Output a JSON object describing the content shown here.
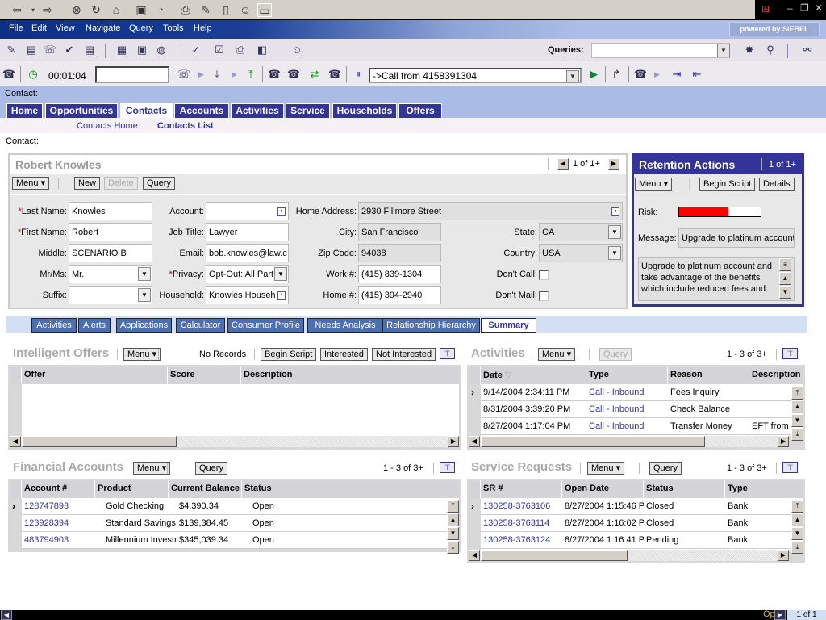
{
  "browser": {
    "icons": [
      "back-icon",
      "forward-icon",
      "stop-icon",
      "refresh-icon",
      "home-icon",
      "folder-icon",
      "history-icon",
      "print-icon",
      "edit-icon",
      "document-icon",
      "user-icon",
      "window-icon"
    ]
  },
  "menu": [
    "File",
    "Edit",
    "View",
    "Navigate",
    "Query",
    "Tools",
    "Help"
  ],
  "powered_by": "powered by SIEBEL",
  "toolbar": {
    "queries_label": "Queries:",
    "queries_value": ""
  },
  "comm": {
    "timer": "00:01:04",
    "input_value": "",
    "call_select": "->Call from 4158391304"
  },
  "context_label": "Contact:",
  "tabs": [
    {
      "label": "Home"
    },
    {
      "label": "Opportunities"
    },
    {
      "label": "Contacts",
      "active": true
    },
    {
      "label": "Accounts"
    },
    {
      "label": "Activities"
    },
    {
      "label": "Service"
    },
    {
      "label": "Households"
    },
    {
      "label": "Offers"
    }
  ],
  "subnav": {
    "home": "Contacts Home",
    "list": "Contacts List"
  },
  "page_label": "Contact:",
  "contact": {
    "title": "Robert Knowles",
    "pager": "1 of 1+",
    "buttons": {
      "menu": "Menu ▾",
      "new": "New",
      "delete": "Delete",
      "query": "Query"
    },
    "fields": {
      "last_name": {
        "label": "Last Name:",
        "value": "Knowles"
      },
      "first_name": {
        "label": "First Name:",
        "value": "Robert"
      },
      "middle": {
        "label": "Middle:",
        "value": "SCENARIO B"
      },
      "mrms": {
        "label": "Mr/Ms:",
        "value": "Mr."
      },
      "suffix": {
        "label": "Suffix:",
        "value": ""
      },
      "account": {
        "label": "Account:",
        "value": ""
      },
      "job_title": {
        "label": "Job Title:",
        "value": "Lawyer"
      },
      "email": {
        "label": "Email:",
        "value": "bob.knowles@law.c"
      },
      "privacy": {
        "label": "Privacy:",
        "value": "Opt-Out: All Part"
      },
      "household": {
        "label": "Household:",
        "value": "Knowles Househ"
      },
      "home_address": {
        "label": "Home Address:",
        "value": "2930 Fillmore Street"
      },
      "city": {
        "label": "City:",
        "value": "San Francisco"
      },
      "zip": {
        "label": "Zip Code:",
        "value": "94038"
      },
      "work": {
        "label": "Work #:",
        "value": "(415) 839-1304"
      },
      "home": {
        "label": "Home #:",
        "value": "(415) 394-2940"
      },
      "state": {
        "label": "State:",
        "value": "CA"
      },
      "country": {
        "label": "Country:",
        "value": "USA"
      },
      "dont_call": {
        "label": "Don't Call:",
        "checked": false
      },
      "dont_mail": {
        "label": "Don't Mail:",
        "checked": false
      }
    }
  },
  "retention": {
    "title": "Retention Actions",
    "pager": "1 of 1+",
    "menu": "Menu ▾",
    "begin_script": "Begin Script",
    "details": "Details",
    "risk_label": "Risk:",
    "risk_level": 0.6,
    "risk_color": "#ff0000",
    "message_label": "Message:",
    "message": "Upgrade to platinum account",
    "body": "Upgrade to platinum account and take advantage of the benefits which include reduced fees and"
  },
  "subtabs": [
    {
      "label": "Activities"
    },
    {
      "label": "Alerts"
    },
    {
      "label": "Applications"
    },
    {
      "label": "Calculator"
    },
    {
      "label": "Consumer Profile"
    },
    {
      "label": "Needs Analysis"
    },
    {
      "label": "Relationship Hierarchy"
    },
    {
      "label": "Summary",
      "active": true
    }
  ],
  "offers": {
    "title": "Intelligent Offers",
    "menu": "Menu ▾",
    "status": "No Records",
    "begin_script": "Begin Script",
    "interested": "Interested",
    "not_interested": "Not Interested",
    "columns": [
      "Offer",
      "Score",
      "Description"
    ]
  },
  "activities": {
    "title": "Activities",
    "menu": "Menu ▾",
    "query": "Query",
    "count": "1 - 3 of 3+",
    "columns": [
      "Date",
      "Type",
      "Reason",
      "Description"
    ],
    "rows": [
      [
        "9/14/2004 2:34:11 PM",
        "Call - Inbound",
        "Fees Inquiry",
        ""
      ],
      [
        "8/31/2004 3:39:20 PM",
        "Call - Inbound",
        "Check Balance",
        ""
      ],
      [
        "8/27/2004 1:17:04 PM",
        "Call - Inbound",
        "Transfer Money",
        "EFT from \\"
      ]
    ]
  },
  "financial": {
    "title": "Financial Accounts",
    "menu": "Menu ▾",
    "query": "Query",
    "count": "1 - 3 of 3+",
    "columns": [
      "Account #",
      "Product",
      "Current Balance",
      "Status"
    ],
    "rows": [
      [
        "128747893",
        "Gold Checking",
        "$4,390.34",
        "Open"
      ],
      [
        "123928394",
        "Standard Savings",
        "$139,384.45",
        "Open"
      ],
      [
        "483794903",
        "Millennium Investmer",
        "$345,039.34",
        "Open"
      ]
    ]
  },
  "service": {
    "title": "Service Requests",
    "menu": "Menu ▾",
    "query": "Query",
    "count": "1 - 3 of 3+",
    "columns": [
      "SR #",
      "Open Date",
      "Status",
      "Type"
    ],
    "rows": [
      [
        "130258-3763106",
        "8/27/2004 1:15:46 P",
        "Closed",
        "Bank"
      ],
      [
        "130258-3763114",
        "8/27/2004 1:16:02 P",
        "Closed",
        "Bank"
      ],
      [
        "130258-3763124",
        "8/27/2004 1:16:41 P",
        "Pending",
        "Bank"
      ]
    ]
  },
  "statusbar": {
    "text": "Op",
    "pager": "1 of 1"
  }
}
